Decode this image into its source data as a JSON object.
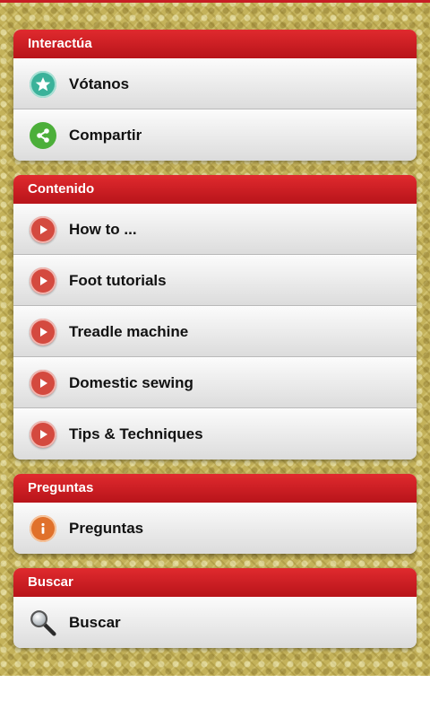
{
  "sections": {
    "interactua": {
      "title": "Interactúa",
      "items": [
        {
          "label": "Vótanos",
          "icon": "star-icon"
        },
        {
          "label": "Compartir",
          "icon": "share-icon"
        }
      ]
    },
    "contenido": {
      "title": "Contenido",
      "items": [
        {
          "label": "How to ...",
          "icon": "play-icon"
        },
        {
          "label": "Foot tutorials",
          "icon": "play-icon"
        },
        {
          "label": "Treadle machine",
          "icon": "play-icon"
        },
        {
          "label": "Domestic sewing",
          "icon": "play-icon"
        },
        {
          "label": "Tips & Techniques",
          "icon": "play-icon"
        }
      ]
    },
    "preguntas": {
      "title": "Preguntas",
      "items": [
        {
          "label": "Preguntas",
          "icon": "info-icon"
        }
      ]
    },
    "buscar": {
      "title": "Buscar",
      "items": [
        {
          "label": "Buscar",
          "icon": "search-icon"
        }
      ]
    }
  },
  "colors": {
    "header_red": "#c71e24",
    "background_gold": "#c4b25a",
    "play_red": "#d44a3f",
    "star_teal": "#3bb29a",
    "share_green": "#4caf3a",
    "info_orange": "#e0712b"
  }
}
